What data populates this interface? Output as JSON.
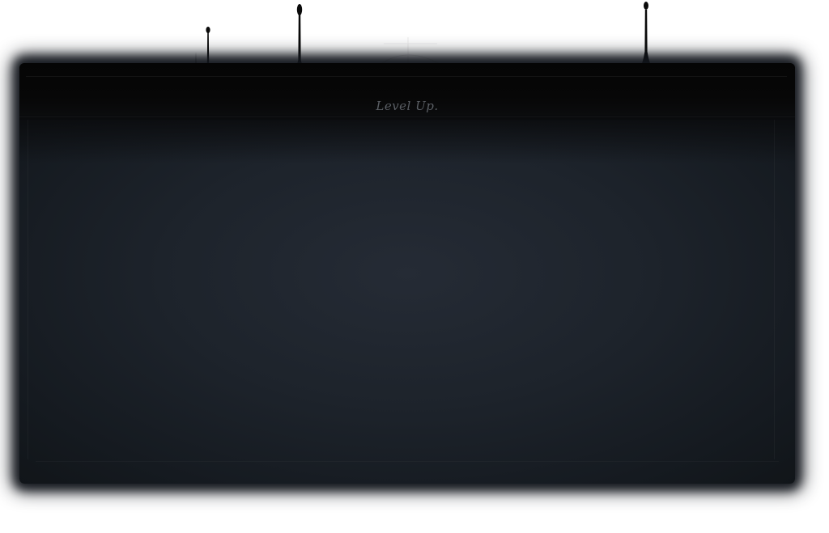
{
  "header": {
    "tagline": "Level Up."
  },
  "colors": {
    "background": "#ffffff",
    "panel_center": "#252b35",
    "panel_edge": "#111519",
    "header_band": "#050505",
    "tagline_text": "#5a5e64",
    "drip": "#0a0a0a"
  },
  "icons": {
    "drips": [
      "ink-drip-icon",
      "ink-drip-icon",
      "ink-drip-icon",
      "ink-drip-icon"
    ],
    "ornament": "thin-arc-ornament-icon"
  }
}
